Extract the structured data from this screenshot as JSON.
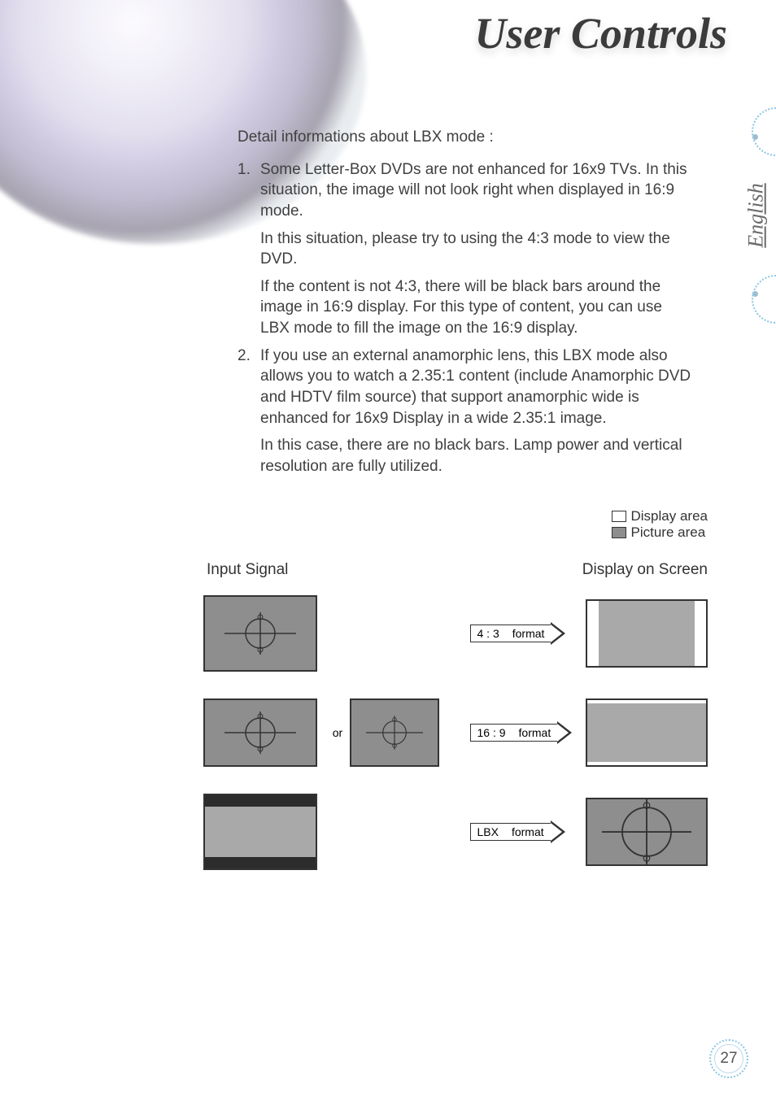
{
  "title": "User Controls",
  "language_tab": "English",
  "page_number": "27",
  "intro": "Detail informations about LBX mode :",
  "list": [
    {
      "n": "1.",
      "lead": "Some Letter-Box DVDs are not enhanced for 16x9 TVs. In this situation, the image will not look right when displayed in 16:9 mode.",
      "subs": [
        "In this situation, please try to using the 4:3 mode to view the DVD.",
        "If the content is not 4:3, there will be black bars around the image in 16:9 display. For this type of content, you can use LBX mode to fill the image on the 16:9 display."
      ]
    },
    {
      "n": "2.",
      "lead": "If you use an external anamorphic lens, this LBX mode also allows you to watch a 2.35:1 content (include Anamorphic DVD and HDTV film source) that support anamorphic wide is enhanced for 16x9 Display in a wide 2.35:1 image.",
      "subs": [
        "In this case, there are no black bars. Lamp power and vertical resolution are fully utilized."
      ]
    }
  ],
  "legend": {
    "display_area": "Display area",
    "picture_area": "Picture area"
  },
  "headers": {
    "input": "Input Signal",
    "output": "Display on Screen"
  },
  "or_label": "or",
  "formats": {
    "r1_ratio": "4 : 3",
    "r1_word": "format",
    "r2_ratio": "16 : 9",
    "r2_word": "format",
    "r3_ratio": "LBX",
    "r3_word": "format"
  }
}
